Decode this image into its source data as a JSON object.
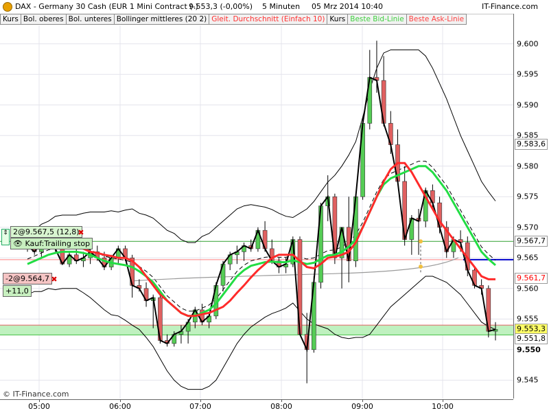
{
  "window": {
    "instrument": "DAX - Germany 30 Cash (EUR 1 Mini Contract (-)",
    "last": "9.553,3 (-0,00%)",
    "interval": "5 Minuten",
    "datetime": "05 Mrz 2014 10:40",
    "provider": "IT-Finance.com"
  },
  "legend": [
    {
      "label": "Kurs",
      "color": "#000000"
    },
    {
      "label": "Bol. oberes",
      "color": "#000000"
    },
    {
      "label": "Bol. unteres",
      "color": "#000000"
    },
    {
      "label": "Bollinger mittleres (20 2)",
      "color": "#000000"
    },
    {
      "label": "Gleit. Durchschnitt (Einfach 10)",
      "color": "#ff3030"
    },
    {
      "label": "Kurs",
      "color": "#000000"
    },
    {
      "label": "Beste Bid-Linie",
      "color": "#40d040"
    },
    {
      "label": "Beste Ask-Linie",
      "color": "#ff4040"
    }
  ],
  "orders": {
    "open_position": "2@9.567,5 (12,8)",
    "trailing_stop": "Kauf:Trailing stop",
    "short_order": "-2@9.564,7",
    "short_pl": "+11,0"
  },
  "price_badges": [
    {
      "label": "9.583,6",
      "value": 9583.6,
      "bg": "#ffffff",
      "color": "#000000"
    },
    {
      "label": "9.567,7",
      "value": 9567.7,
      "bg": "#ffffff",
      "color": "#000000"
    },
    {
      "label": "9.561,7",
      "value": 9561.7,
      "bg": "#ffffff",
      "color": "#ff0000"
    },
    {
      "label": "9.553,3",
      "value": 9553.3,
      "bg": "#ffff66",
      "color": "#000000"
    },
    {
      "label": "9.551,8",
      "value": 9551.8,
      "bg": "#ffffff",
      "color": "#000000"
    }
  ],
  "copyright": "© IT-Finance.com",
  "colors": {
    "bull": "#55cc55",
    "bear": "#e06060",
    "sma": "#ff2a2a",
    "bb_mid": "#22dd44",
    "accent_blue": "#0000cc"
  },
  "chart_data": {
    "type": "candlestick",
    "title": "DAX - Germany 30 Cash (EUR 1 Mini Contract (-)",
    "xlabel": "",
    "ylabel": "",
    "ylim": [
      9542,
      9603
    ],
    "y_ticks": [
      9545,
      9550,
      9555,
      9560,
      9565,
      9570,
      9575,
      9580,
      9585,
      9590,
      9595,
      9600
    ],
    "y_tick_labels": [
      "9.545",
      "9.550",
      "9.555",
      "9.560",
      "9.565",
      "9.570",
      "9.575",
      "9.580",
      "9.585",
      "9.590",
      "9.595",
      "9.600"
    ],
    "x_ticks": [
      "05:00",
      "06:00",
      "07:00",
      "08:00",
      "09:00",
      "10:00"
    ],
    "grid": true,
    "candles": [
      {
        "o": 9568.0,
        "h": 9569.0,
        "l": 9566.0,
        "c": 9567.0
      },
      {
        "o": 9567.0,
        "h": 9568.0,
        "l": 9565.5,
        "c": 9566.0
      },
      {
        "o": 9566.0,
        "h": 9568.0,
        "l": 9565.0,
        "c": 9567.5
      },
      {
        "o": 9567.5,
        "h": 9570.0,
        "l": 9566.5,
        "c": 9569.0
      },
      {
        "o": 9569.0,
        "h": 9569.5,
        "l": 9566.0,
        "c": 9566.5
      },
      {
        "o": 9566.5,
        "h": 9567.0,
        "l": 9564.0,
        "c": 9564.0
      },
      {
        "o": 9564.0,
        "h": 9566.0,
        "l": 9563.5,
        "c": 9565.5
      },
      {
        "o": 9565.5,
        "h": 9566.5,
        "l": 9564.0,
        "c": 9564.5
      },
      {
        "o": 9564.5,
        "h": 9566.0,
        "l": 9563.5,
        "c": 9565.0
      },
      {
        "o": 9565.0,
        "h": 9566.5,
        "l": 9564.0,
        "c": 9566.0
      },
      {
        "o": 9566.0,
        "h": 9567.0,
        "l": 9564.5,
        "c": 9565.0
      },
      {
        "o": 9565.0,
        "h": 9566.0,
        "l": 9563.0,
        "c": 9563.5
      },
      {
        "o": 9563.5,
        "h": 9565.5,
        "l": 9563.0,
        "c": 9565.0
      },
      {
        "o": 9565.0,
        "h": 9567.0,
        "l": 9564.0,
        "c": 9566.5
      },
      {
        "o": 9566.5,
        "h": 9567.0,
        "l": 9564.5,
        "c": 9565.0
      },
      {
        "o": 9565.0,
        "h": 9565.5,
        "l": 9558.5,
        "c": 9560.5
      },
      {
        "o": 9560.5,
        "h": 9561.5,
        "l": 9559.5,
        "c": 9560.0
      },
      {
        "o": 9560.0,
        "h": 9561.0,
        "l": 9557.0,
        "c": 9558.0
      },
      {
        "o": 9558.0,
        "h": 9559.0,
        "l": 9553.5,
        "c": 9558.5
      },
      {
        "o": 9558.5,
        "h": 9559.0,
        "l": 9551.0,
        "c": 9551.5
      },
      {
        "o": 9551.5,
        "h": 9552.5,
        "l": 9550.5,
        "c": 9551.0
      },
      {
        "o": 9551.0,
        "h": 9553.0,
        "l": 9550.5,
        "c": 9552.5
      },
      {
        "o": 9552.5,
        "h": 9554.0,
        "l": 9551.0,
        "c": 9553.0
      },
      {
        "o": 9553.0,
        "h": 9555.0,
        "l": 9551.0,
        "c": 9554.5
      },
      {
        "o": 9554.5,
        "h": 9557.0,
        "l": 9553.5,
        "c": 9556.5
      },
      {
        "o": 9556.5,
        "h": 9557.5,
        "l": 9554.0,
        "c": 9554.5
      },
      {
        "o": 9554.5,
        "h": 9556.0,
        "l": 9553.5,
        "c": 9555.5
      },
      {
        "o": 9555.5,
        "h": 9561.0,
        "l": 9555.0,
        "c": 9560.5
      },
      {
        "o": 9560.5,
        "h": 9564.5,
        "l": 9559.5,
        "c": 9564.0
      },
      {
        "o": 9564.0,
        "h": 9566.0,
        "l": 9563.0,
        "c": 9565.5
      },
      {
        "o": 9565.5,
        "h": 9567.0,
        "l": 9564.0,
        "c": 9566.0
      },
      {
        "o": 9566.0,
        "h": 9567.5,
        "l": 9564.5,
        "c": 9567.0
      },
      {
        "o": 9567.0,
        "h": 9568.0,
        "l": 9566.0,
        "c": 9566.5
      },
      {
        "o": 9566.5,
        "h": 9570.0,
        "l": 9566.0,
        "c": 9569.5
      },
      {
        "o": 9569.5,
        "h": 9571.0,
        "l": 9566.0,
        "c": 9566.5
      },
      {
        "o": 9566.5,
        "h": 9568.0,
        "l": 9564.0,
        "c": 9564.5
      },
      {
        "o": 9564.5,
        "h": 9565.0,
        "l": 9562.5,
        "c": 9563.5
      },
      {
        "o": 9563.5,
        "h": 9565.0,
        "l": 9562.5,
        "c": 9564.0
      },
      {
        "o": 9564.0,
        "h": 9568.5,
        "l": 9563.5,
        "c": 9568.0
      },
      {
        "o": 9568.0,
        "h": 9568.5,
        "l": 9558.5,
        "c": 9552.5
      },
      {
        "o": 9552.5,
        "h": 9556.0,
        "l": 9544.5,
        "c": 9550.0
      },
      {
        "o": 9550.0,
        "h": 9562.0,
        "l": 9549.5,
        "c": 9561.0
      },
      {
        "o": 9561.0,
        "h": 9574.0,
        "l": 9560.0,
        "c": 9573.5
      },
      {
        "o": 9573.5,
        "h": 9578.5,
        "l": 9571.0,
        "c": 9575.0
      },
      {
        "o": 9575.0,
        "h": 9575.5,
        "l": 9564.0,
        "c": 9565.0
      },
      {
        "o": 9565.0,
        "h": 9570.0,
        "l": 9560.0,
        "c": 9570.0
      },
      {
        "o": 9570.0,
        "h": 9575.0,
        "l": 9561.0,
        "c": 9564.5
      },
      {
        "o": 9564.5,
        "h": 9575.5,
        "l": 9563.5,
        "c": 9575.0
      },
      {
        "o": 9575.0,
        "h": 9588.0,
        "l": 9574.5,
        "c": 9587.0
      },
      {
        "o": 9587.0,
        "h": 9599.0,
        "l": 9586.0,
        "c": 9594.5
      },
      {
        "o": 9594.5,
        "h": 9600.5,
        "l": 9592.0,
        "c": 9594.0
      },
      {
        "o": 9594.0,
        "h": 9598.0,
        "l": 9586.5,
        "c": 9587.0
      },
      {
        "o": 9587.0,
        "h": 9589.0,
        "l": 9582.0,
        "c": 9583.5
      },
      {
        "o": 9583.5,
        "h": 9586.0,
        "l": 9577.0,
        "c": 9577.5
      },
      {
        "o": 9577.5,
        "h": 9580.0,
        "l": 9567.0,
        "c": 9568.0
      },
      {
        "o": 9568.0,
        "h": 9572.0,
        "l": 9565.5,
        "c": 9571.5
      },
      {
        "o": 9571.5,
        "h": 9573.0,
        "l": 9565.5,
        "c": 9571.0
      },
      {
        "o": 9571.0,
        "h": 9576.5,
        "l": 9570.0,
        "c": 9576.0
      },
      {
        "o": 9576.0,
        "h": 9577.0,
        "l": 9573.0,
        "c": 9574.0
      },
      {
        "o": 9574.0,
        "h": 9575.0,
        "l": 9569.0,
        "c": 9570.0
      },
      {
        "o": 9570.0,
        "h": 9571.0,
        "l": 9565.0,
        "c": 9566.0
      },
      {
        "o": 9566.0,
        "h": 9568.5,
        "l": 9565.0,
        "c": 9568.0
      },
      {
        "o": 9568.0,
        "h": 9569.5,
        "l": 9566.0,
        "c": 9567.5
      },
      {
        "o": 9567.5,
        "h": 9568.5,
        "l": 9562.0,
        "c": 9563.0
      },
      {
        "o": 9563.0,
        "h": 9563.5,
        "l": 9560.0,
        "c": 9560.5
      },
      {
        "o": 9560.5,
        "h": 9561.5,
        "l": 9559.0,
        "c": 9560.0
      },
      {
        "o": 9560.0,
        "h": 9560.5,
        "l": 9552.0,
        "c": 9553.0
      },
      {
        "o": 9553.0,
        "h": 9554.5,
        "l": 9551.5,
        "c": 9553.3
      }
    ],
    "series": [
      {
        "name": "Bollinger mittleres (20 2)",
        "values": [
          9564,
          9564.5,
          9565,
          9565.5,
          9565.8,
          9566,
          9566,
          9566,
          9565.8,
          9565.5,
          9565,
          9564.5,
          9564.2,
          9564,
          9563.8,
          9563.5,
          9562.8,
          9562,
          9561,
          9559.5,
          9558,
          9557,
          9556,
          9555.5,
          9555.5,
          9556,
          9556.5,
          9557.5,
          9559,
          9560.5,
          9562,
          9563,
          9563.7,
          9564,
          9564.3,
          9564.4,
          9564.3,
          9564.3,
          9564.6,
          9564.3,
          9564,
          9564.2,
          9564.8,
          9565.4,
          9565.5,
          9566,
          9566.8,
          9568,
          9570,
          9572.5,
          9575,
          9577,
          9578,
          9578.5,
          9579,
          9579.5,
          9580,
          9580,
          9579,
          9577.5,
          9576,
          9574,
          9572,
          9570,
          9568,
          9566,
          9564.8,
          9563.8
        ]
      },
      {
        "name": "Gleit. Durchschnitt (Einfach 10)",
        "values": [
          9567.5,
          9567.5,
          9567.8,
          9568,
          9567.8,
          9567.5,
          9567,
          9566.8,
          9566.5,
          9566,
          9565.8,
          9565.5,
          9565.3,
          9565,
          9565,
          9564.5,
          9563.5,
          9562,
          9560.5,
          9559,
          9558,
          9557,
          9556,
          9555.5,
          9555.5,
          9555.8,
          9556,
          9556.5,
          9557,
          9558,
          9559.3,
          9560.5,
          9561.8,
          9563,
          9564,
          9565,
          9565.5,
          9565.5,
          9565.5,
          9564.5,
          9563.5,
          9563.3,
          9564,
          9565,
          9565.2,
          9565.5,
          9566,
          9567.5,
          9570,
          9572.5,
          9575,
          9577.5,
          9579.5,
          9580.5,
          9580.5,
          9579,
          9577,
          9575,
          9573,
          9571,
          9569.5,
          9568,
          9566.5,
          9565,
          9563.5,
          9562,
          9561.5,
          9561.5
        ]
      }
    ]
  }
}
